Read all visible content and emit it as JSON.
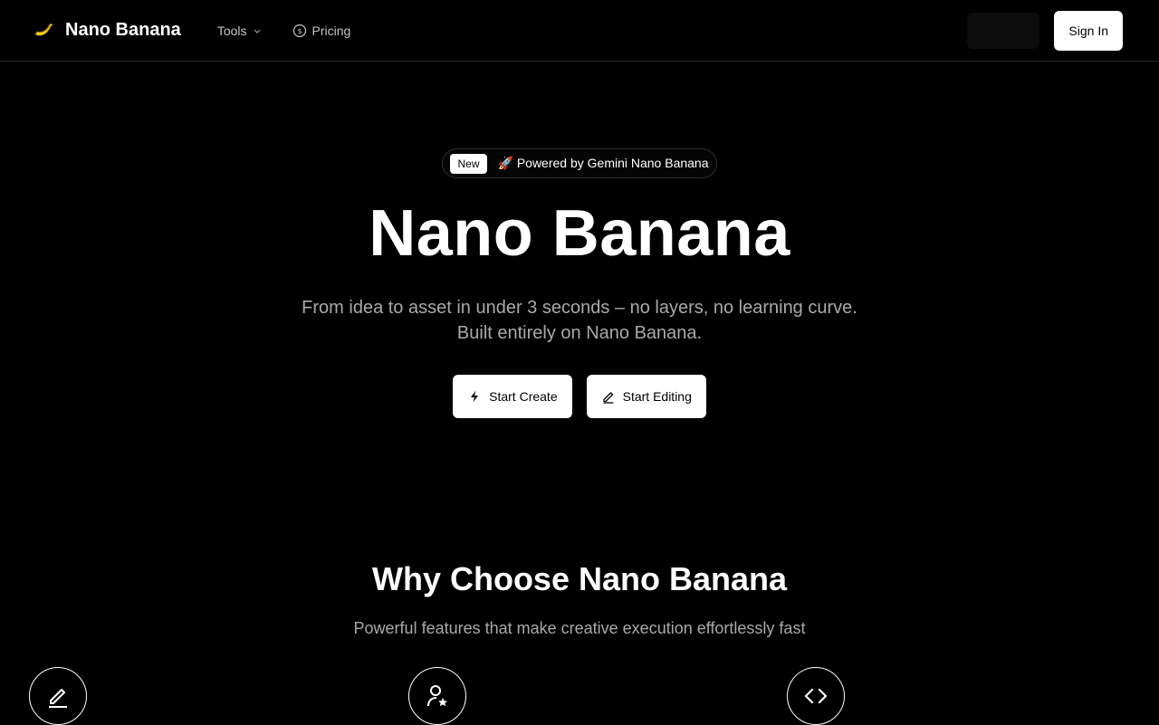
{
  "nav": {
    "brand_name": "Nano Banana",
    "links": [
      {
        "label": "Tools",
        "icon": "chevron-down-icon"
      },
      {
        "label": "Pricing",
        "icon": "dollar-circle-icon"
      }
    ],
    "sign_in_label": "Sign In"
  },
  "hero": {
    "badge_new": "New",
    "badge_text": "🚀 Powered by Gemini Nano Banana",
    "title": "Nano Banana",
    "subtitle_line1": "From idea to asset in under 3 seconds – no layers, no learning curve.",
    "subtitle_line2": "Built entirely on Nano Banana.",
    "cta_create": "Start Create",
    "cta_edit": "Start Editing"
  },
  "why": {
    "title": "Why Choose Nano Banana",
    "subtitle": "Powerful features that make creative execution effortlessly fast",
    "feature_icons": [
      "pencil-line-icon",
      "user-star-icon",
      "code-icon"
    ]
  },
  "colors": {
    "background": "#000000",
    "text": "#ffffff",
    "muted": "#a9a9a9",
    "border": "#262626",
    "brand_yellow": "#f5c518"
  }
}
